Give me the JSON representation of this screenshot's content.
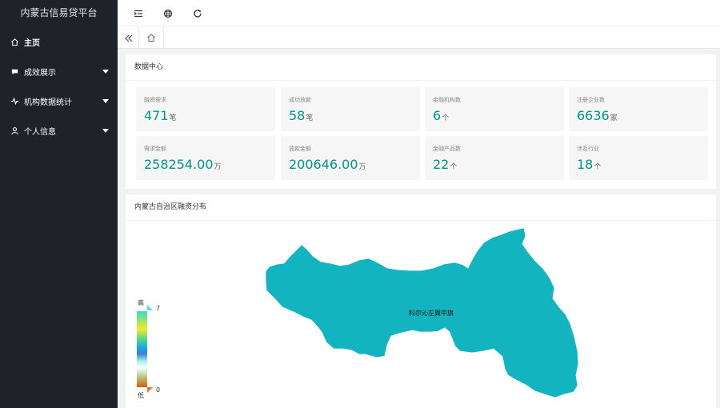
{
  "app": {
    "title": "内蒙古信易贷平台"
  },
  "sidebar": {
    "items": [
      {
        "label": "主页",
        "icon": "home-icon"
      },
      {
        "label": "成效展示",
        "icon": "chat-bubble-icon"
      },
      {
        "label": "机构数据统计",
        "icon": "pulse-icon"
      },
      {
        "label": "个人信息",
        "icon": "user-icon"
      }
    ]
  },
  "header": {
    "icons": [
      "menu-toggle-icon",
      "globe-icon",
      "refresh-icon"
    ]
  },
  "tabs": {
    "home_icon": "home-icon",
    "collapse_icon": "double-chevron-left-icon"
  },
  "data_center": {
    "title": "数据中心",
    "stats": [
      {
        "label": "融资需求",
        "value": "471",
        "unit": "笔"
      },
      {
        "label": "成功放款",
        "value": "58",
        "unit": "笔"
      },
      {
        "label": "金融机构数",
        "value": "6",
        "unit": "个"
      },
      {
        "label": "注册企业数",
        "value": "6636",
        "unit": "家"
      },
      {
        "label": "需求金额",
        "value": "258254.00",
        "unit": "万"
      },
      {
        "label": "放款金额",
        "value": "200646.00",
        "unit": "万"
      },
      {
        "label": "金融产品数",
        "value": "22",
        "unit": "个"
      },
      {
        "label": "涉及行业",
        "value": "18",
        "unit": "个"
      }
    ]
  },
  "map": {
    "title": "内蒙古自治区融资分布",
    "region_label": "科尔沁左翼中旗",
    "region_color": "#12b5bf",
    "legend": {
      "high_label": "高",
      "low_label": "低",
      "max": "7",
      "min": "0"
    }
  },
  "colors": {
    "accent": "#009688",
    "sidebar_bg": "#20222a"
  }
}
